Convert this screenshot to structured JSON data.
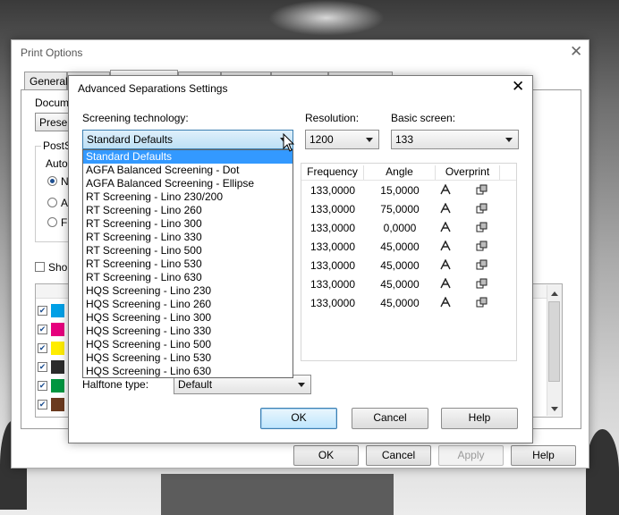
{
  "print_options": {
    "title": "Print Options",
    "tabs": [
      "General",
      "",
      "",
      "",
      "",
      "",
      ""
    ],
    "doc_label": "Docum",
    "preset_combo": "Presen",
    "postscript_label": "PostS",
    "auto_label": "Auto",
    "radio_labels": [
      "N",
      "A",
      "Fi"
    ],
    "show_label": "Sho",
    "buttons": {
      "ok": "OK",
      "cancel": "Cancel",
      "apply": "Apply",
      "help": "Help"
    }
  },
  "adv_dialog": {
    "title": "Advanced Separations Settings",
    "screening_label": "Screening technology:",
    "screening_value": "Standard Defaults",
    "resolution_label": "Resolution:",
    "resolution_value": "1200",
    "basic_screen_label": "Basic screen:",
    "basic_screen_value": "133",
    "halftone_label": "Halftone type:",
    "halftone_value": "Default",
    "buttons": {
      "ok": "OK",
      "cancel": "Cancel",
      "help": "Help"
    }
  },
  "screening_options": [
    "Standard Defaults",
    "AGFA Balanced Screening - Dot",
    "AGFA Balanced Screening - Ellipse",
    "RT Screening - Lino 230/200",
    "RT Screening - Lino 260",
    "RT Screening - Lino 300",
    "RT Screening - Lino 330",
    "RT Screening - Lino 500",
    "RT Screening - Lino 530",
    "RT Screening - Lino 630",
    "HQS Screening - Lino 230",
    "HQS Screening - Lino 260",
    "HQS Screening - Lino 300",
    "HQS Screening - Lino 330",
    "HQS Screening - Lino 500",
    "HQS Screening - Lino 530",
    "HQS Screening - Lino 630"
  ],
  "table": {
    "headers": [
      "Frequency",
      "Angle",
      "Overprint"
    ],
    "rows": [
      {
        "frequency": "133,0000",
        "angle": "15,0000"
      },
      {
        "frequency": "133,0000",
        "angle": "75,0000"
      },
      {
        "frequency": "133,0000",
        "angle": "0,0000"
      },
      {
        "frequency": "133,0000",
        "angle": "45,0000"
      },
      {
        "frequency": "133,0000",
        "angle": "45,0000"
      },
      {
        "frequency": "133,0000",
        "angle": "45,0000"
      },
      {
        "frequency": "133,0000",
        "angle": "45,0000"
      }
    ]
  },
  "swatch_colors": [
    "#00a0e6",
    "#e6007e",
    "#ffed00",
    "#2b2b2b",
    "#009640",
    "#6b3a1f"
  ],
  "icons": {
    "text_overprint": "text-overprint-icon",
    "graphic_overprint": "graphic-overprint-icon"
  }
}
